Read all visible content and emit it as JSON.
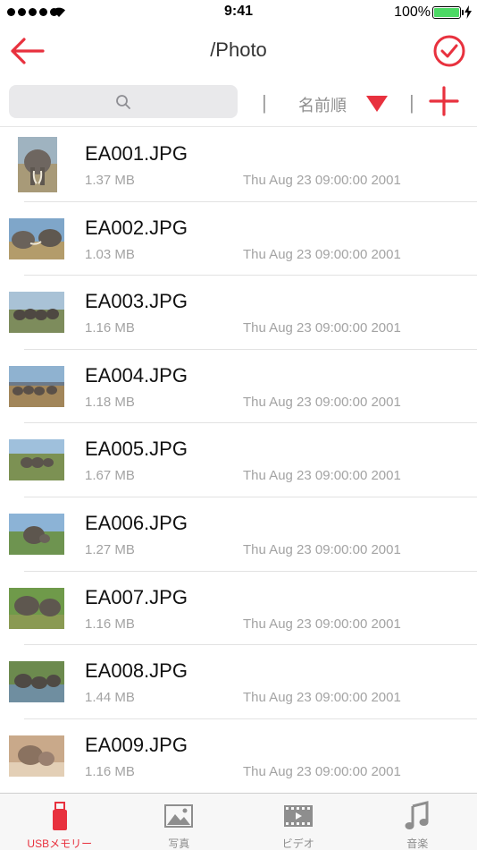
{
  "status_bar": {
    "time": "9:41",
    "battery": "100%"
  },
  "nav": {
    "title": "/Photo"
  },
  "toolbar": {
    "search_placeholder": "",
    "sort_label": "名前順"
  },
  "files": [
    {
      "name": "EA001.JPG",
      "size": "1.37 MB",
      "date": "Thu Aug 23 09:00:00 2001"
    },
    {
      "name": "EA002.JPG",
      "size": "1.03 MB",
      "date": "Thu Aug 23 09:00:00 2001"
    },
    {
      "name": "EA003.JPG",
      "size": "1.16 MB",
      "date": "Thu Aug 23 09:00:00 2001"
    },
    {
      "name": "EA004.JPG",
      "size": "1.18 MB",
      "date": "Thu Aug 23 09:00:00 2001"
    },
    {
      "name": "EA005.JPG",
      "size": "1.67 MB",
      "date": "Thu Aug 23 09:00:00 2001"
    },
    {
      "name": "EA006.JPG",
      "size": "1.27 MB",
      "date": "Thu Aug 23 09:00:00 2001"
    },
    {
      "name": "EA007.JPG",
      "size": "1.16 MB",
      "date": "Thu Aug 23 09:00:00 2001"
    },
    {
      "name": "EA008.JPG",
      "size": "1.44 MB",
      "date": "Thu Aug 23 09:00:00 2001"
    },
    {
      "name": "EA009.JPG",
      "size": "1.16 MB",
      "date": "Thu Aug 23 09:00:00 2001"
    }
  ],
  "tabs": [
    {
      "label": "USBメモリー",
      "icon": "usb-drive-icon",
      "active": true
    },
    {
      "label": "写真",
      "icon": "photo-icon",
      "active": false
    },
    {
      "label": "ビデオ",
      "icon": "video-icon",
      "active": false
    },
    {
      "label": "音楽",
      "icon": "music-note-icon",
      "active": false
    }
  ],
  "colors": {
    "accent": "#e8313e",
    "battery": "#4cd964",
    "tab_inactive": "#8e8e8e"
  }
}
